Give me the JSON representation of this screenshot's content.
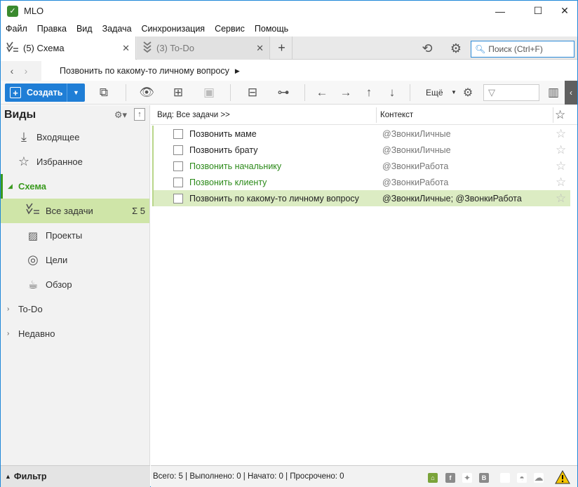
{
  "window": {
    "title": "MLO",
    "app_icon": "mlo-leaf-icon"
  },
  "menu": [
    "Файл",
    "Правка",
    "Вид",
    "Задача",
    "Синхронизация",
    "Сервис",
    "Помощь"
  ],
  "tabs": [
    {
      "label": "(5) Схема",
      "active": true
    },
    {
      "label": "(3) To-Do",
      "active": false
    }
  ],
  "search": {
    "placeholder": "Поиск (Ctrl+F)"
  },
  "breadcrumb": {
    "text": "Позвонить по какому-то личному вопросу"
  },
  "toolbar": {
    "create_label": "Создать",
    "more_label": "Ещё"
  },
  "sidebar": {
    "title": "Виды",
    "items": [
      {
        "label": "Входящее",
        "icon": "inbox-icon"
      },
      {
        "label": "Избранное",
        "icon": "star-outline-icon"
      },
      {
        "label": "Схема",
        "icon": "collapse-triangle-icon"
      },
      {
        "label": "Все задачи",
        "icon": "all-tasks-icon",
        "count": "Σ 5"
      },
      {
        "label": "Проекты",
        "icon": "projects-icon"
      },
      {
        "label": "Цели",
        "icon": "target-icon"
      },
      {
        "label": "Обзор",
        "icon": "coffee-cup-icon"
      },
      {
        "label": "To-Do",
        "icon": "expand-triangle-icon"
      },
      {
        "label": "Недавно",
        "icon": "expand-triangle-icon"
      }
    ]
  },
  "content": {
    "col_view": "Вид: Все задачи >>",
    "col_context": "Контекст",
    "tasks": [
      {
        "name": "Позвонить маме",
        "context": "@ЗвонкиЛичные",
        "style": "normal"
      },
      {
        "name": "Позвонить брату",
        "context": "@ЗвонкиЛичные",
        "style": "normal"
      },
      {
        "name": "Позвонить начальнику",
        "context": "@ЗвонкиРабота",
        "style": "green"
      },
      {
        "name": "Позвонить клиенту",
        "context": "@ЗвонкиРабота",
        "style": "green"
      },
      {
        "name": "Позвонить по какому-то личному вопросу",
        "context": "@ЗвонкиЛичные; @ЗвонкиРабота",
        "style": "selected"
      }
    ]
  },
  "status": {
    "filter_label": "Фильтр",
    "summary": "Всего: 5 | Выполнено: 0 | Начато: 0 | Просрочено: 0"
  },
  "colors": {
    "accent": "#1f7ed6",
    "green": "#3a9a1e",
    "selection": "#cfe5a8"
  }
}
